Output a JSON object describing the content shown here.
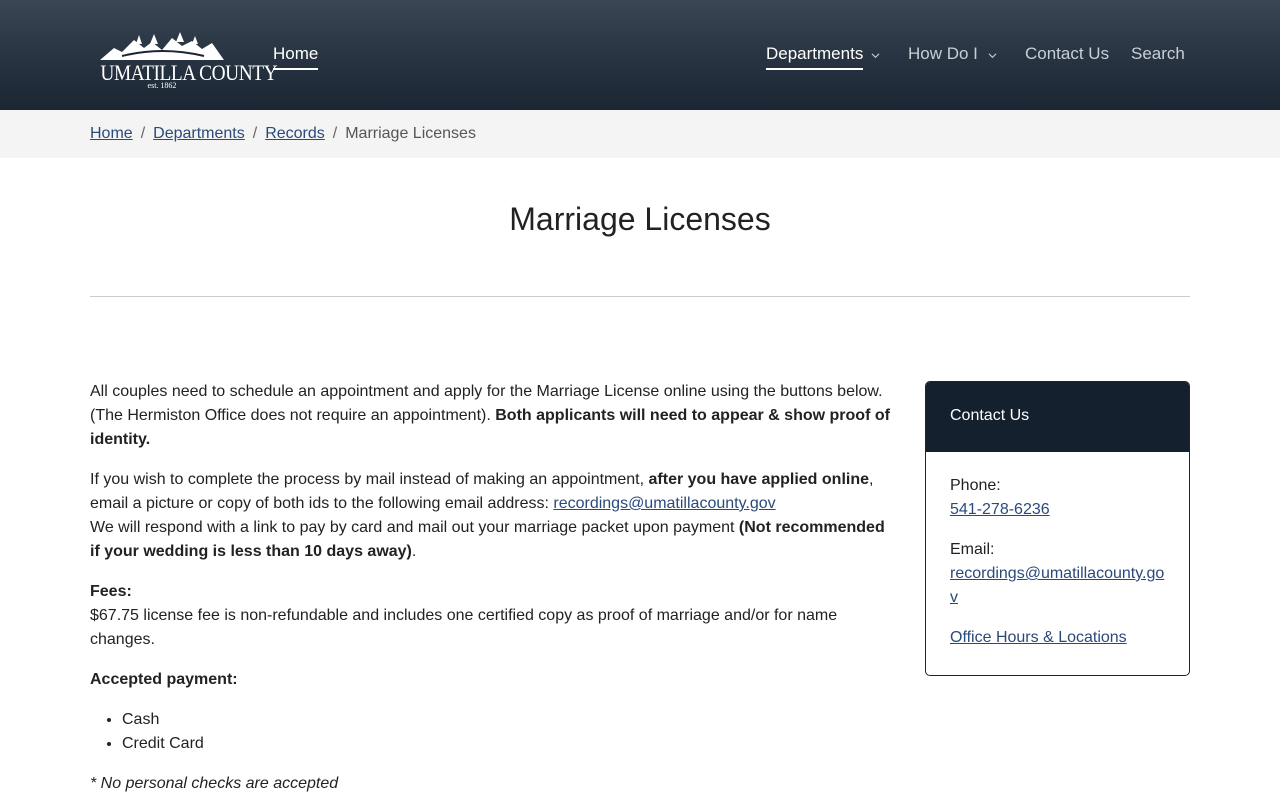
{
  "header": {
    "logo": {
      "title": "UMATILLA COUNTY",
      "est": "est. 1862"
    },
    "nav": {
      "home": "Home",
      "departments": "Departments",
      "how_do_i": "How Do I",
      "contact_us": "Contact Us",
      "search": "Search"
    }
  },
  "breadcrumb": {
    "home": "Home",
    "departments": "Departments",
    "records": "Records",
    "current": "Marriage Licenses",
    "separator": "/"
  },
  "page": {
    "title": "Marriage Licenses"
  },
  "content": {
    "p1_text": "All couples need to schedule an appointment and apply for the Marriage License online using the buttons below. (The Hermiston Office does not require an appointment). ",
    "p1_bold": "Both applicants will need to appear & show proof of identity.",
    "p2_text_a": "If you wish to complete the process by mail instead of making an appointment, ",
    "p2_bold": "after you have applied online",
    "p2_text_b": ", email a picture or copy of both ids to the following email address: ",
    "p2_email": "recordings@umatillacounty.gov",
    "p2_text_c": "We will respond with a link to pay by card and mail out your marriage packet upon payment ",
    "p2_bold_b": "(Not recommended if your wedding is less than 10 days away)",
    "p2_text_d": ".",
    "fees_label": "Fees:",
    "fees_text": "$67.75 license fee is non-refundable and includes one certified copy as proof of marriage and/or for name changes.",
    "payment_label": "Accepted payment:",
    "payment_methods": [
      "Cash",
      "Credit Card"
    ],
    "checks_note": "* No personal checks are accepted"
  },
  "contact_card": {
    "title": "Contact Us",
    "phone_label": "Phone:",
    "phone": "541-278-6236",
    "email_label": "Email:",
    "email": "recordings@umatillacounty.gov",
    "hours_link": "Office Hours & Locations"
  },
  "colors": {
    "header_bg": "#1b2633",
    "link": "#2a4a7a",
    "card_head": "#14202e",
    "breadcrumb_bg": "#f4f4f4"
  }
}
